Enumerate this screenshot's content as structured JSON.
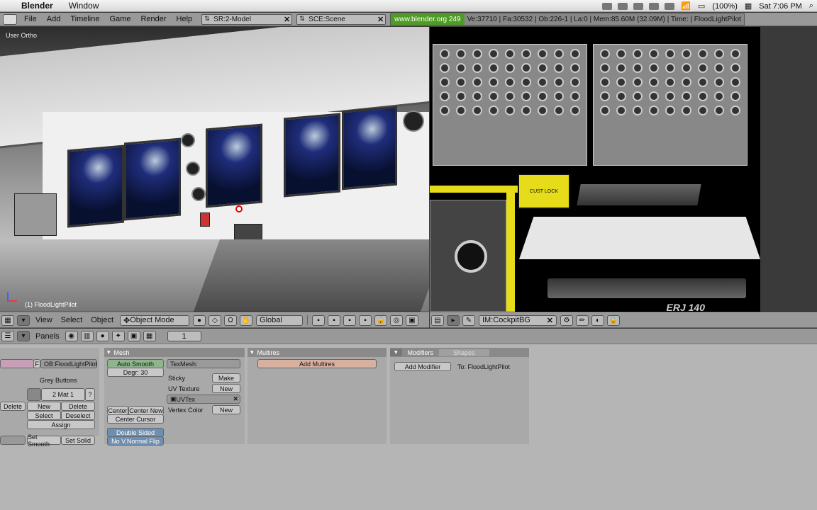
{
  "mac_menubar": {
    "app": "Blender",
    "menu": [
      "Window"
    ],
    "battery": "(100%)",
    "clock": "Sat 7:06 PM"
  },
  "header": {
    "menus": [
      "File",
      "Add",
      "Timeline",
      "Game",
      "Render",
      "Help"
    ],
    "screen": "SR:2-Model",
    "scene": "SCE:Scene",
    "url": "www.blender.org 249",
    "stats": "Ve:37710 | Fa:30532 | Ob:226-1 | La:0 | Mem:85.60M (32.09M) | Time: | FloodLightPilot"
  },
  "viewport": {
    "view_label": "User Ortho",
    "object_label": "(1) FloodLightPilot"
  },
  "viewport_header": {
    "menus": [
      "View",
      "Select",
      "Object"
    ],
    "mode": "Object Mode",
    "orientation": "Global"
  },
  "image_window": {
    "image_field": "IM:CockpitBG",
    "erj_text": "ERJ 140",
    "label_text": "CUST LOCK"
  },
  "buttons_header": {
    "panels_label": "Panels",
    "frame": "1"
  },
  "link_panel": {
    "object_field": "OB:FloodLightPilot",
    "f_label": "F",
    "grey_buttons": "Grey Buttons",
    "mat_field": "2 Mat 1",
    "question": "?",
    "delete": "Delete",
    "new": "New",
    "delete2": "Delete",
    "select": "Select",
    "deselect": "Deselect",
    "assign": "Assign",
    "set_smooth": "Set Smooth",
    "set_solid": "Set Solid"
  },
  "mesh_panel": {
    "title": "Mesh",
    "auto_smooth": "Auto Smooth",
    "degr": "Degr: 30",
    "texmesh": "TexMesh:",
    "sticky": "Sticky",
    "make": "Make",
    "uv_texture": "UV Texture",
    "new1": "New",
    "uvtex": "UVTex",
    "vertex_color": "Vertex Color",
    "new2": "New",
    "center": "Center",
    "center_new": "Center New",
    "center_cursor": "Center Cursor",
    "double_sided": "Double Sided",
    "no_vnormal_flip": "No V.Normal Flip"
  },
  "multires_panel": {
    "title": "Multires",
    "add_multires": "Add Multires"
  },
  "modifiers_panel": {
    "tab_modifiers": "Modifiers",
    "tab_shapes": "Shapes",
    "add_modifier": "Add Modifier",
    "to_label": "To: FloodLightPilot"
  }
}
